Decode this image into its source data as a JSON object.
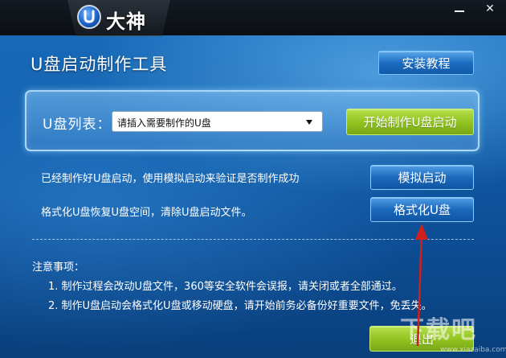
{
  "titlebar": {
    "logo_text": "大神",
    "minimize_label": "",
    "close_label": "✕"
  },
  "main": {
    "title": "U盘启动制作工具",
    "install_tutorial_label": "安装教程",
    "usb_list_label": "U盘列表：",
    "usb_select_value": "请插入需要制作的U盘",
    "start_button_label": "开始制作U盘启动",
    "simulate_text": "已经制作好U盘启动，使用模拟启动来验证是否制作成功",
    "simulate_button_label": "模拟启动",
    "format_text": "格式化U盘恢复U盘空间，清除U盘启动文件。",
    "format_button_label": "格式化U盘"
  },
  "notes": {
    "title": "注意事项：",
    "items": [
      "1. 制作过程会改动U盘文件，360等安全软件会误报，请关闭或者全部通过。",
      "2. 制作U盘启动会格式化U盘或移动硬盘，请开始前务必备份好重要文件，免丢失。"
    ]
  },
  "footer": {
    "exit_button_label": "退出"
  },
  "watermark": {
    "text": "下载吧",
    "url": "www.xiazaiba.com"
  },
  "colors": {
    "accent_green": "#8fc21f",
    "accent_blue": "#1c68bb",
    "annotation_red": "#d0201c"
  }
}
